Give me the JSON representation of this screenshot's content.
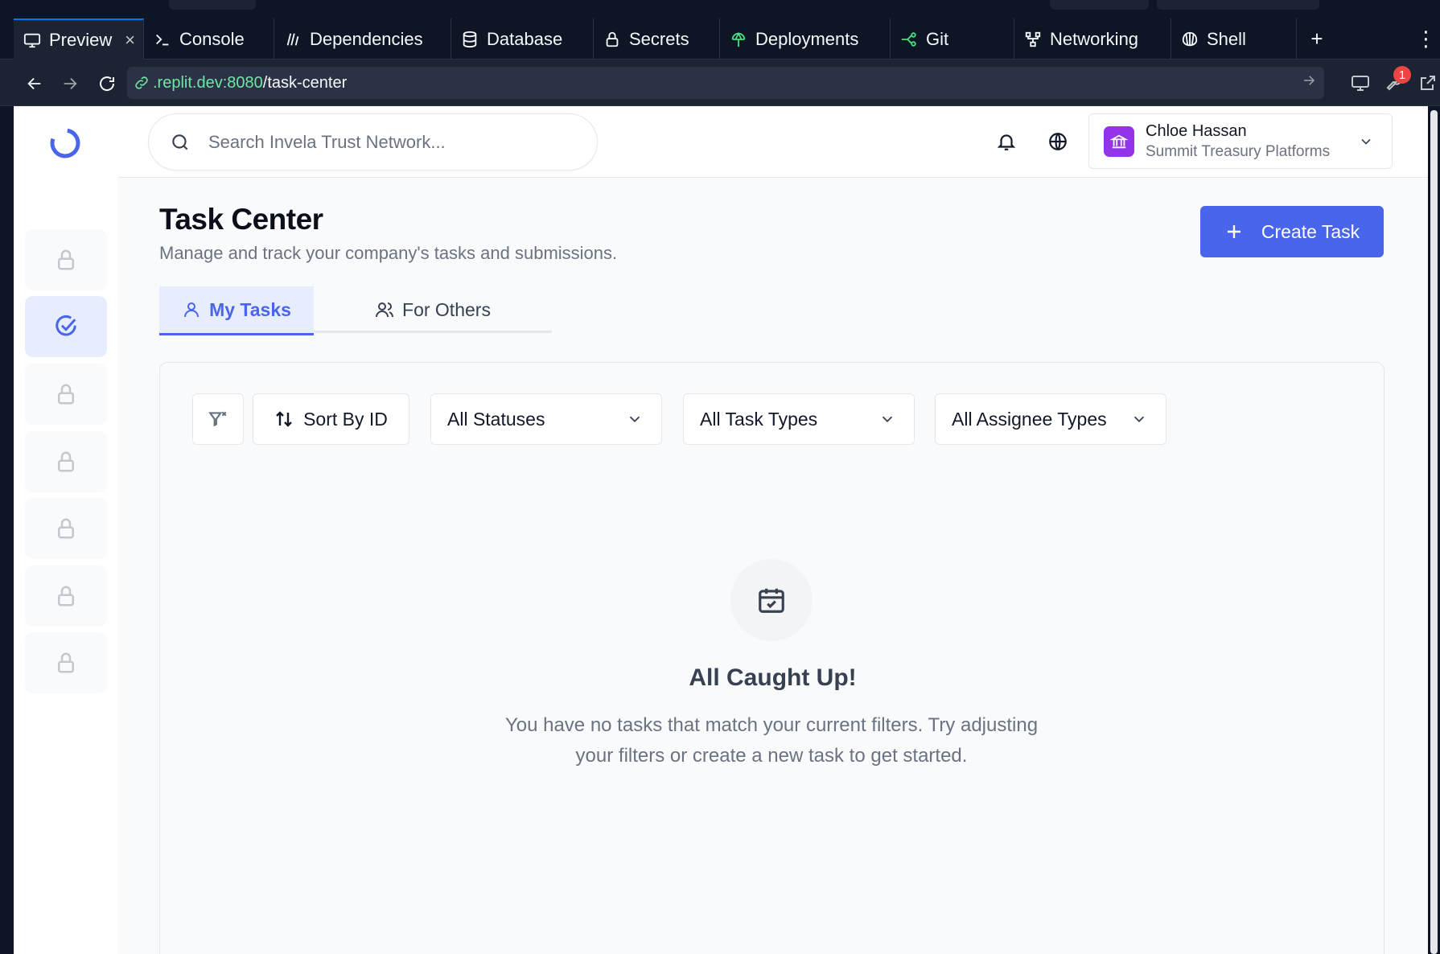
{
  "ide": {
    "tabs": [
      {
        "label": "Preview",
        "icon": "monitor-icon",
        "active": true,
        "closable": "×"
      },
      {
        "label": "Console",
        "icon": "terminal-icon"
      },
      {
        "label": "Dependencies",
        "icon": "packages-icon"
      },
      {
        "label": "Database",
        "icon": "database-icon"
      },
      {
        "label": "Secrets",
        "icon": "lock-icon"
      },
      {
        "label": "Deployments",
        "icon": "deploy-icon"
      },
      {
        "label": "Git",
        "icon": "git-icon"
      },
      {
        "label": "Networking",
        "icon": "network-icon"
      },
      {
        "label": "Shell",
        "icon": "shell-icon"
      }
    ],
    "new_tab": "+",
    "more": "⋮",
    "url": {
      "host": ".replit.dev:8080",
      "path": "/task-center"
    },
    "devtools_badge": "1"
  },
  "header": {
    "search_placeholder": "Search Invela Trust Network...",
    "user": {
      "name": "Chloe Hassan",
      "company": "Summit Treasury Platforms"
    }
  },
  "sidebar": {
    "items": [
      {
        "icon": "lock-icon",
        "locked": true
      },
      {
        "icon": "check-circle-icon",
        "active": true
      },
      {
        "icon": "lock-icon",
        "locked": true
      },
      {
        "icon": "lock-icon",
        "locked": true
      },
      {
        "icon": "lock-icon",
        "locked": true
      },
      {
        "icon": "lock-icon",
        "locked": true
      },
      {
        "icon": "lock-icon",
        "locked": true
      }
    ]
  },
  "page": {
    "title": "Task Center",
    "subtitle": "Manage and track your company's tasks and submissions.",
    "create_label": "Create Task",
    "tabs": {
      "mine": "My Tasks",
      "others": "For Others"
    },
    "filters": {
      "sort_label": "Sort By ID",
      "status": "All Statuses",
      "task_type": "All Task Types",
      "assignee_type": "All Assignee Types"
    },
    "empty": {
      "title": "All Caught Up!",
      "text": "You have no tasks that match your current filters. Try adjusting your filters or create a new task to get started."
    }
  },
  "colors": {
    "accent": "#4965ec",
    "ide_bg": "#0e1525",
    "avatar": "#9333ea",
    "url_host": "#6ee7a3"
  }
}
